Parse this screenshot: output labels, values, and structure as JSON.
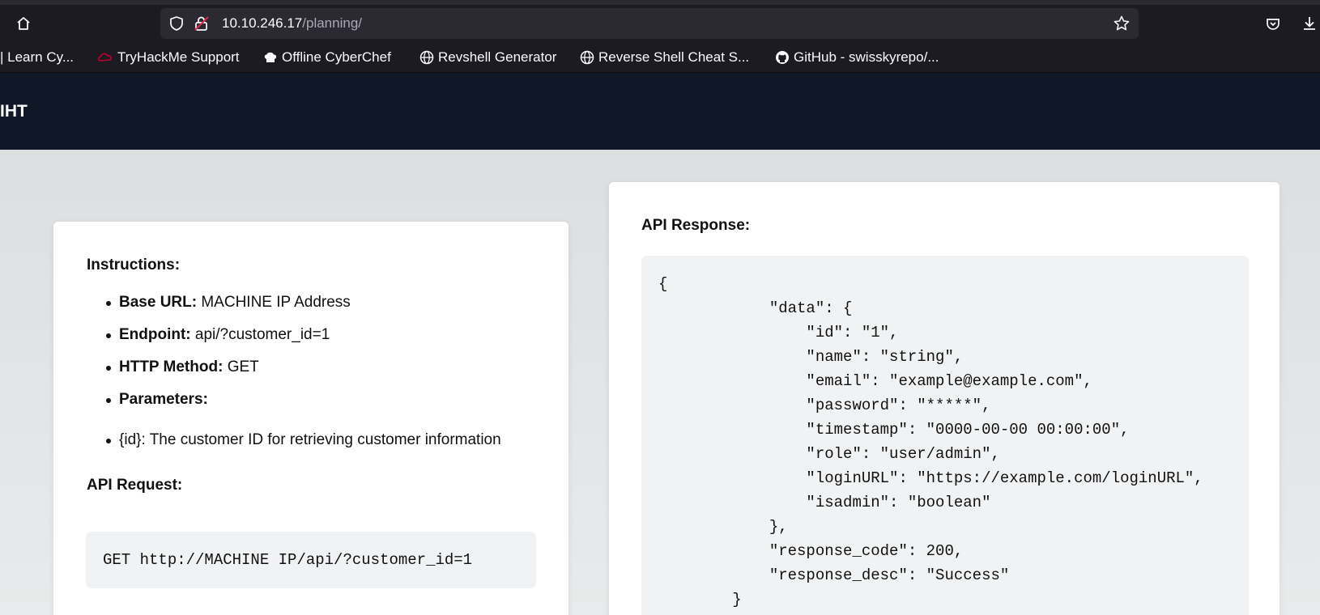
{
  "browser": {
    "url_host": "10.10.246.17",
    "url_path": "/planning/",
    "bookmarks": [
      "| Learn Cy...",
      "TryHackMe Support",
      "Offline CyberChef",
      "Revshell Generator",
      "Reverse Shell Cheat S...",
      "GitHub - swisskyrepo/..."
    ]
  },
  "site": {
    "logo_text": "IHT"
  },
  "instructions": {
    "heading": "Instructions:",
    "items": [
      {
        "label": "Base URL:",
        "value": " MACHINE IP Address"
      },
      {
        "label": "Endpoint:",
        "value": " api/?customer_id=1"
      },
      {
        "label": "HTTP Method:",
        "value": " GET"
      },
      {
        "label": "Parameters:",
        "value": ""
      }
    ],
    "param_text": "{id}: The customer ID for retrieving customer information",
    "request_heading": "API Request:",
    "request_code": "GET http://MACHINE IP/api/?customer_id=1"
  },
  "response": {
    "heading": "API Response:",
    "body": "{\n            \"data\": {\n                \"id\": \"1\",\n                \"name\": \"string\",\n                \"email\": \"example@example.com\",\n                \"password\": \"*****\",\n                \"timestamp\": \"0000-00-00 00:00:00\",\n                \"role\": \"user/admin\",\n                \"loginURL\": \"https://example.com/loginURL\",\n                \"isadmin\": \"boolean\"\n            },\n            \"response_code\": 200,\n            \"response_desc\": \"Success\"\n        }"
  },
  "colors": {
    "chrome_bg": "#1c1b22",
    "urlbar_bg": "#2b2a33",
    "site_header_bg": "#101827",
    "page_bg": "#e4e6e7",
    "code_bg": "#f1f2f3"
  }
}
